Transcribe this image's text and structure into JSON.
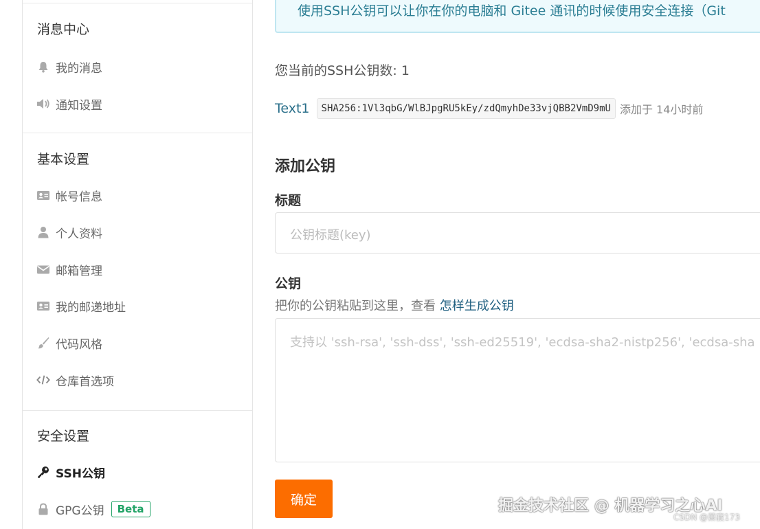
{
  "sidebar": {
    "sections": [
      {
        "title": "消息中心",
        "items": [
          {
            "label": "我的消息",
            "icon": "bell-icon"
          },
          {
            "label": "通知设置",
            "icon": "speaker-icon"
          }
        ]
      },
      {
        "title": "基本设置",
        "items": [
          {
            "label": "帐号信息",
            "icon": "id-card-icon"
          },
          {
            "label": "个人资料",
            "icon": "user-icon"
          },
          {
            "label": "邮箱管理",
            "icon": "envelope-icon"
          },
          {
            "label": "我的邮递地址",
            "icon": "address-card-icon"
          },
          {
            "label": "代码风格",
            "icon": "brush-icon"
          },
          {
            "label": "仓库首选项",
            "icon": "code-icon"
          }
        ]
      },
      {
        "title": "安全设置",
        "items": [
          {
            "label": "SSH公钥",
            "icon": "key-icon",
            "active": true
          },
          {
            "label": "GPG公钥",
            "icon": "lock-icon",
            "badge": "Beta"
          }
        ]
      }
    ]
  },
  "main": {
    "notice": "使用SSH公钥可以让你在你的电脑和 Gitee 通讯的时候使用安全连接（Git",
    "key_count": "您当前的SSH公钥数: 1",
    "keys": [
      {
        "name": "Text1",
        "fingerprint": "SHA256:1Vl3qbG/WlBJpgRU5kEy/zdQmyhDe33vjQBB2VmD9mU",
        "added": "添加于 14小时前"
      }
    ],
    "add_heading": "添加公钥",
    "title_label": "标题",
    "title_placeholder": "公钥标题(key)",
    "key_label": "公钥",
    "hint_text": "把你的公钥粘贴到这里，查看 ",
    "hint_link": "怎样生成公钥",
    "key_placeholder": "支持以 'ssh-rsa', 'ssh-dss', 'ssh-ed25519', 'ecdsa-sha2-nistp256', 'ecdsa-sha",
    "submit_label": "确定"
  },
  "watermark": {
    "main": "掘金技术社区 @ 机器学习之心AI",
    "sub": "CSDN @萧寂173"
  },
  "colors": {
    "accent": "#fc6d00",
    "badge": "#21a366",
    "link": "#1f5f80"
  }
}
